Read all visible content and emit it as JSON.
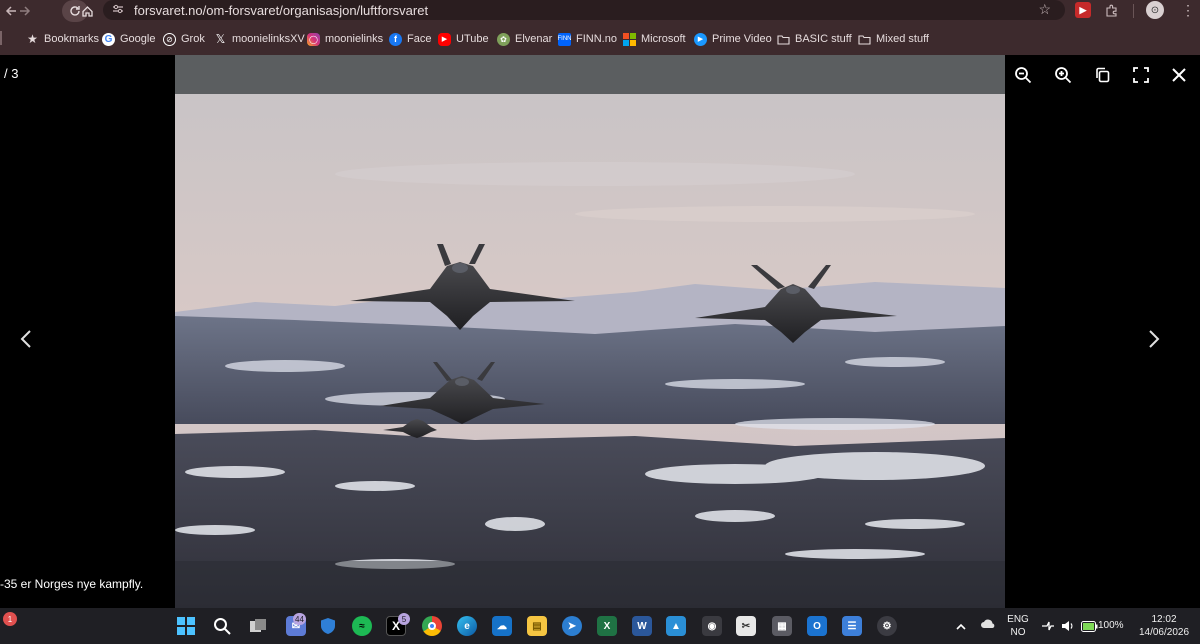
{
  "browser": {
    "url": "forsvaret.no/om-forsvaret/organisasjon/luftforsvaret",
    "profile_label": "⊙",
    "extension_label": "▶"
  },
  "bookmarks": [
    {
      "label": "Bookmarks",
      "icon": "star-icon",
      "color": "#e6dcdd"
    },
    {
      "label": "Google",
      "icon": "google-icon",
      "color": "#ffffff"
    },
    {
      "label": "Grok",
      "icon": "grok-icon",
      "color": "#ffffff"
    },
    {
      "label": "moonielinksXV",
      "icon": "x-icon",
      "color": "#ffffff"
    },
    {
      "label": "moonielinks",
      "icon": "instagram-icon",
      "color": "#d6307a"
    },
    {
      "label": "Face",
      "icon": "facebook-icon",
      "color": "#1877f2"
    },
    {
      "label": "UTube",
      "icon": "youtube-icon",
      "color": "#ff0000"
    },
    {
      "label": "Elvenar",
      "icon": "elvenar-icon",
      "color": "#7fa05a"
    },
    {
      "label": "FINN.no",
      "icon": "finn-icon",
      "color": "#0063fb"
    },
    {
      "label": "Microsoft",
      "icon": "microsoft-icon",
      "color": "#f25022"
    },
    {
      "label": "Prime Video",
      "icon": "prime-video-icon",
      "color": "#1a98ff"
    },
    {
      "label": "BASIC stuff",
      "icon": "folder-icon",
      "color": "#e6dcdd"
    },
    {
      "label": "Mixed stuff",
      "icon": "folder-icon",
      "color": "#e6dcdd"
    }
  ],
  "viewer": {
    "counter": "/ 3",
    "caption": "-35 er Norges nye kampfly.",
    "prev_glyph": "‹",
    "next_glyph": "›",
    "image_alt": "F-35 fighter jets over snowy Norwegian landscape"
  },
  "taskbar": {
    "notification_count": "1",
    "mail_badge": "44",
    "x_badge": "5",
    "language": "ENG",
    "region": "NO",
    "battery": "100%",
    "time": "12:02",
    "date": "14/06/2026"
  }
}
